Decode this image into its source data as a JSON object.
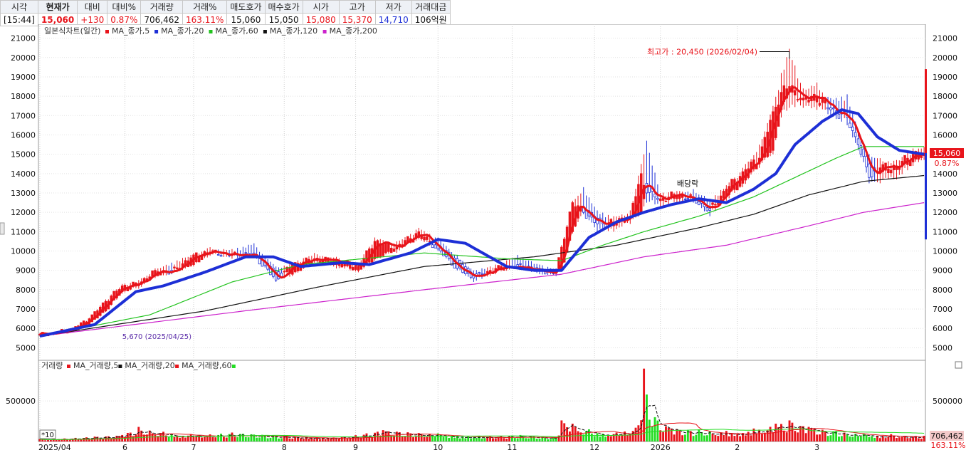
{
  "quote": {
    "headers": [
      "시각",
      "현재가",
      "대비",
      "대비%",
      "거래량",
      "거래%",
      "매도호가",
      "매수호가",
      "시가",
      "고가",
      "저가",
      "거래대금"
    ],
    "values": [
      "[15:44]",
      "15,060",
      "+130",
      "0.87%",
      "706,462",
      "163.11%",
      "15,060",
      "15,050",
      "15,080",
      "15,370",
      "14,710",
      "106억원"
    ]
  },
  "colors": {
    "up": "#e8141b",
    "down": "#1d2fd6",
    "ma5": "#e8141b",
    "ma20": "#1d2fd6",
    "ma60": "#22c31e",
    "ma120": "#111111",
    "ma200": "#cc22cc",
    "vol": "#22dd22"
  },
  "chart_data": [
    {
      "type": "candlestick",
      "title": "일본식차트(일간)",
      "legend": [
        "MA_종가,5",
        "MA_종가,20",
        "MA_종가,60",
        "MA_종가,120",
        "MA_종가,200"
      ],
      "ylim": [
        4500,
        21500
      ],
      "y_ticks": [
        5000,
        6000,
        7000,
        8000,
        9000,
        10000,
        11000,
        12000,
        13000,
        14000,
        15000,
        16000,
        17000,
        18000,
        19000,
        20000,
        21000
      ],
      "x_ticks": [
        "2025/04",
        "6",
        "7",
        "8",
        "9",
        "10",
        "11",
        "12",
        "2026",
        "2",
        "3"
      ],
      "x_tick_index": [
        0,
        31,
        56,
        89,
        115,
        145,
        172,
        202,
        226,
        254,
        283
      ],
      "ohlc_keypoints": [
        {
          "i": 0,
          "o": 5650,
          "h": 5750,
          "l": 5600,
          "c": 5700
        },
        {
          "i": 5,
          "o": 5700,
          "h": 5800,
          "l": 5650,
          "c": 5780
        },
        {
          "i": 12,
          "o": 5850,
          "h": 6050,
          "l": 5800,
          "c": 6000
        },
        {
          "i": 18,
          "o": 6200,
          "h": 6550,
          "l": 6150,
          "c": 6500
        },
        {
          "i": 24,
          "o": 6900,
          "h": 7500,
          "l": 6850,
          "c": 7400
        },
        {
          "i": 30,
          "o": 7900,
          "h": 8300,
          "l": 7800,
          "c": 8200
        },
        {
          "i": 36,
          "o": 8200,
          "h": 8500,
          "l": 8050,
          "c": 8300
        },
        {
          "i": 42,
          "o": 8700,
          "h": 9100,
          "l": 8600,
          "c": 9000
        },
        {
          "i": 48,
          "o": 9000,
          "h": 9400,
          "l": 8800,
          "c": 8900
        },
        {
          "i": 56,
          "o": 9300,
          "h": 9900,
          "l": 9200,
          "c": 9800
        },
        {
          "i": 62,
          "o": 9900,
          "h": 10200,
          "l": 9750,
          "c": 9950
        },
        {
          "i": 70,
          "o": 9800,
          "h": 10100,
          "l": 9600,
          "c": 9800
        },
        {
          "i": 78,
          "o": 9900,
          "h": 10400,
          "l": 9700,
          "c": 9800
        },
        {
          "i": 86,
          "o": 9000,
          "h": 9200,
          "l": 8400,
          "c": 8500
        },
        {
          "i": 92,
          "o": 8800,
          "h": 9400,
          "l": 8700,
          "c": 9300
        },
        {
          "i": 100,
          "o": 9500,
          "h": 9900,
          "l": 9400,
          "c": 9600
        },
        {
          "i": 108,
          "o": 9300,
          "h": 9700,
          "l": 9100,
          "c": 9500
        },
        {
          "i": 116,
          "o": 9000,
          "h": 9400,
          "l": 8900,
          "c": 9200
        },
        {
          "i": 122,
          "o": 9600,
          "h": 10700,
          "l": 9500,
          "c": 10500
        },
        {
          "i": 130,
          "o": 10100,
          "h": 10500,
          "l": 9900,
          "c": 10200
        },
        {
          "i": 138,
          "o": 10700,
          "h": 11200,
          "l": 10600,
          "c": 11000
        },
        {
          "i": 145,
          "o": 10300,
          "h": 10700,
          "l": 10000,
          "c": 10100
        },
        {
          "i": 152,
          "o": 9600,
          "h": 9800,
          "l": 9000,
          "c": 9100
        },
        {
          "i": 158,
          "o": 8800,
          "h": 9000,
          "l": 8400,
          "c": 8600
        },
        {
          "i": 166,
          "o": 8900,
          "h": 9300,
          "l": 8800,
          "c": 9100
        },
        {
          "i": 174,
          "o": 9300,
          "h": 9800,
          "l": 9100,
          "c": 9200
        },
        {
          "i": 182,
          "o": 9100,
          "h": 9300,
          "l": 8800,
          "c": 9000
        },
        {
          "i": 188,
          "o": 9000,
          "h": 9100,
          "l": 8700,
          "c": 8850
        },
        {
          "i": 190,
          "o": 9000,
          "h": 10300,
          "l": 8950,
          "c": 10200
        },
        {
          "i": 194,
          "o": 11000,
          "h": 12600,
          "l": 10900,
          "c": 12500
        },
        {
          "i": 198,
          "o": 12300,
          "h": 13300,
          "l": 11900,
          "c": 12000
        },
        {
          "i": 203,
          "o": 11700,
          "h": 12100,
          "l": 11000,
          "c": 11400
        },
        {
          "i": 209,
          "o": 11300,
          "h": 11800,
          "l": 11000,
          "c": 11500
        },
        {
          "i": 215,
          "o": 11700,
          "h": 12100,
          "l": 11400,
          "c": 11800
        },
        {
          "i": 219,
          "o": 12000,
          "h": 14500,
          "l": 11900,
          "c": 14000
        },
        {
          "i": 221,
          "o": 13500,
          "h": 15700,
          "l": 12500,
          "c": 13000
        },
        {
          "i": 226,
          "o": 12600,
          "h": 13000,
          "l": 12300,
          "c": 12700
        },
        {
          "i": 232,
          "o": 12700,
          "h": 13100,
          "l": 12500,
          "c": 12900
        },
        {
          "i": 238,
          "o": 12800,
          "h": 13200,
          "l": 12500,
          "c": 12700
        },
        {
          "i": 244,
          "o": 12200,
          "h": 12700,
          "l": 11800,
          "c": 12100
        },
        {
          "i": 250,
          "o": 12800,
          "h": 13400,
          "l": 12600,
          "c": 13200
        },
        {
          "i": 256,
          "o": 13500,
          "h": 14300,
          "l": 13300,
          "c": 14100
        },
        {
          "i": 262,
          "o": 14500,
          "h": 15500,
          "l": 14300,
          "c": 14800
        },
        {
          "i": 267,
          "o": 15200,
          "h": 17500,
          "l": 15000,
          "c": 17200
        },
        {
          "i": 270,
          "o": 17300,
          "h": 19200,
          "l": 16900,
          "c": 18200
        },
        {
          "i": 273,
          "o": 18200,
          "h": 20450,
          "l": 17400,
          "c": 18500
        },
        {
          "i": 278,
          "o": 17800,
          "h": 18400,
          "l": 17400,
          "c": 17900
        },
        {
          "i": 283,
          "o": 17700,
          "h": 18700,
          "l": 17300,
          "c": 18000
        },
        {
          "i": 288,
          "o": 17400,
          "h": 17900,
          "l": 16900,
          "c": 17300
        },
        {
          "i": 294,
          "o": 17000,
          "h": 18100,
          "l": 16500,
          "c": 16900
        },
        {
          "i": 298,
          "o": 15800,
          "h": 16300,
          "l": 15200,
          "c": 15500
        },
        {
          "i": 302,
          "o": 14500,
          "h": 15000,
          "l": 13500,
          "c": 13800
        },
        {
          "i": 306,
          "o": 14000,
          "h": 14800,
          "l": 13500,
          "c": 14300
        },
        {
          "i": 312,
          "o": 14200,
          "h": 14700,
          "l": 13700,
          "c": 14400
        },
        {
          "i": 318,
          "o": 14600,
          "h": 15300,
          "l": 14400,
          "c": 15000
        },
        {
          "i": 322,
          "o": 14930,
          "h": 15370,
          "l": 14710,
          "c": 15060
        }
      ],
      "ma20_keypoints": [
        [
          0,
          5600
        ],
        [
          20,
          6200
        ],
        [
          35,
          7900
        ],
        [
          45,
          8200
        ],
        [
          60,
          8900
        ],
        [
          75,
          9700
        ],
        [
          85,
          9700
        ],
        [
          95,
          9200
        ],
        [
          110,
          9400
        ],
        [
          120,
          9300
        ],
        [
          135,
          9900
        ],
        [
          145,
          10600
        ],
        [
          155,
          10400
        ],
        [
          170,
          9200
        ],
        [
          180,
          9000
        ],
        [
          190,
          9000
        ],
        [
          200,
          10700
        ],
        [
          210,
          11500
        ],
        [
          220,
          12000
        ],
        [
          230,
          12400
        ],
        [
          240,
          12700
        ],
        [
          250,
          12500
        ],
        [
          260,
          13200
        ],
        [
          268,
          14000
        ],
        [
          275,
          15500
        ],
        [
          285,
          16700
        ],
        [
          292,
          17300
        ],
        [
          298,
          17100
        ],
        [
          305,
          15900
        ],
        [
          313,
          15200
        ],
        [
          322,
          15000
        ]
      ],
      "ma60_keypoints": [
        [
          0,
          5600
        ],
        [
          40,
          6700
        ],
        [
          70,
          8400
        ],
        [
          95,
          9300
        ],
        [
          140,
          9900
        ],
        [
          170,
          9600
        ],
        [
          190,
          9500
        ],
        [
          205,
          10300
        ],
        [
          220,
          11000
        ],
        [
          240,
          11800
        ],
        [
          260,
          12800
        ],
        [
          275,
          13800
        ],
        [
          290,
          14800
        ],
        [
          300,
          15400
        ],
        [
          322,
          15400
        ]
      ],
      "ma120_keypoints": [
        [
          0,
          5600
        ],
        [
          60,
          6900
        ],
        [
          100,
          8100
        ],
        [
          140,
          9200
        ],
        [
          180,
          9700
        ],
        [
          210,
          10300
        ],
        [
          240,
          11200
        ],
        [
          260,
          11900
        ],
        [
          280,
          12900
        ],
        [
          300,
          13600
        ],
        [
          322,
          13900
        ]
      ],
      "ma200_keypoints": [
        [
          0,
          5600
        ],
        [
          80,
          7000
        ],
        [
          140,
          8000
        ],
        [
          190,
          8800
        ],
        [
          220,
          9700
        ],
        [
          250,
          10300
        ],
        [
          280,
          11300
        ],
        [
          300,
          12000
        ],
        [
          322,
          12500
        ]
      ],
      "current_price": "15,060",
      "current_change": "0.87%",
      "annotations": [
        {
          "text": "최고가 : 20,450 (2026/02/04)",
          "x": 273,
          "y": 20450
        },
        {
          "text": "배당락",
          "x": 238,
          "y": 13200
        },
        {
          "text": "5,670 (2025/04/25)",
          "x": 1,
          "y": 5670
        }
      ]
    },
    {
      "type": "bar",
      "title": "거래량",
      "legend": [
        "MA_거래량,5",
        "MA_거래량,20",
        "MA_거래량,60"
      ],
      "ylim": [
        0,
        950000
      ],
      "y_ticks": [
        500000
      ],
      "x_ticks": [
        "2025/04",
        "6",
        "7",
        "8",
        "9",
        "10",
        "11",
        "12",
        "2026",
        "2",
        "3"
      ],
      "scale_label": "*10",
      "current_volume": "706,462",
      "current_volume_pct": "163.11%",
      "volume_keypoints": [
        [
          0,
          30000
        ],
        [
          20,
          60000
        ],
        [
          30,
          80000
        ],
        [
          36,
          180000
        ],
        [
          45,
          120000
        ],
        [
          55,
          90000
        ],
        [
          70,
          110000
        ],
        [
          90,
          70000
        ],
        [
          110,
          60000
        ],
        [
          125,
          140000
        ],
        [
          145,
          100000
        ],
        [
          160,
          70000
        ],
        [
          175,
          80000
        ],
        [
          188,
          50000
        ],
        [
          190,
          260000
        ],
        [
          194,
          220000
        ],
        [
          200,
          150000
        ],
        [
          210,
          110000
        ],
        [
          218,
          200000
        ],
        [
          220,
          900000
        ],
        [
          221,
          580000
        ],
        [
          224,
          300000
        ],
        [
          230,
          160000
        ],
        [
          240,
          150000
        ],
        [
          250,
          130000
        ],
        [
          260,
          160000
        ],
        [
          268,
          220000
        ],
        [
          273,
          260000
        ],
        [
          280,
          180000
        ],
        [
          290,
          130000
        ],
        [
          300,
          100000
        ],
        [
          310,
          90000
        ],
        [
          322,
          70646
        ]
      ]
    }
  ]
}
